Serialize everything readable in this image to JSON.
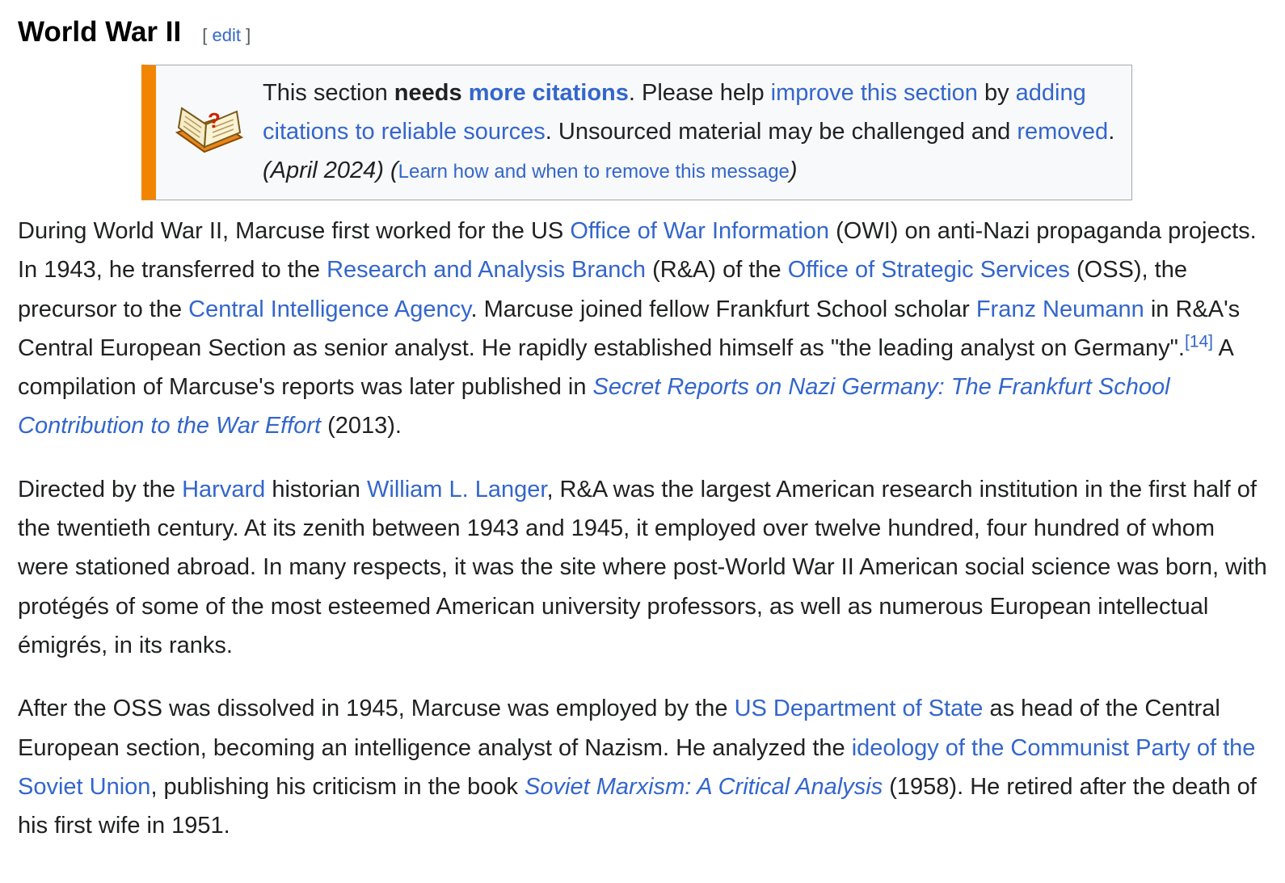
{
  "section": {
    "title": "World War II",
    "edit_open": "[",
    "edit_label": "edit",
    "edit_close": "]"
  },
  "ambox": {
    "icon": "question-book-icon",
    "accent_color": "#f28500",
    "t1": "This section ",
    "needs": "needs",
    "more_citations": "more citations",
    "t2": ". Please help ",
    "improve_link": "improve this section",
    "t3": " by ",
    "adding_link": "adding citations to reliable sources",
    "t4": ". Unsourced material may be challenged and ",
    "removed_link": "removed",
    "t5": ". ",
    "date": "(April 2024)",
    "t6": " (",
    "learn_link": "Learn how and when to remove this message",
    "t7": ")"
  },
  "p1": {
    "a": "During World War II, Marcuse first worked for the US ",
    "owi_link": "Office of War Information",
    "b": " (OWI) on anti-Nazi propaganda projects. In 1943, he transferred to the ",
    "ra_link": "Research and Analysis Branch",
    "c": " (R&A) of the ",
    "oss_link": "Office of Strategic Services",
    "d": " (OSS), the precursor to the ",
    "cia_link": "Central Intelligence Agency",
    "e": ". Marcuse joined fellow Frankfurt School scholar ",
    "neumann_link": "Franz Neumann",
    "f": " in R&A's Central European Section as senior analyst. He rapidly established himself as \"the leading analyst on Germany\".",
    "ref": "[14]",
    "g": " A compilation of Marcuse's reports was later published in ",
    "book_link": "Secret Reports on Nazi Germany: The Frankfurt School Contribution to the War Effort",
    "h": " (2013)."
  },
  "p2": {
    "a": "Directed by the ",
    "harvard_link": "Harvard",
    "b": " historian ",
    "langer_link": "William L. Langer",
    "c": ", R&A was the largest American research institution in the first half of the twentieth century. At its zenith between 1943 and 1945, it employed over twelve hundred, four hundred of whom were stationed abroad. In many respects, it was the site where post-World War II American social science was born, with protégés of some of the most esteemed American university professors, as well as numerous European intellectual émigrés, in its ranks."
  },
  "p3": {
    "a": "After the OSS was dissolved in 1945, Marcuse was employed by the ",
    "state_link": "US Department of State",
    "b": " as head of the Central European section, becoming an intelligence analyst of Nazism. He analyzed the ",
    "ideology_link": "ideology of the Communist Party of the Soviet Union",
    "c": ", publishing his criticism in the book ",
    "book_link": "Soviet Marxism: A Critical Analysis",
    "d": " (1958). He retired after the death of his first wife in 1951."
  }
}
